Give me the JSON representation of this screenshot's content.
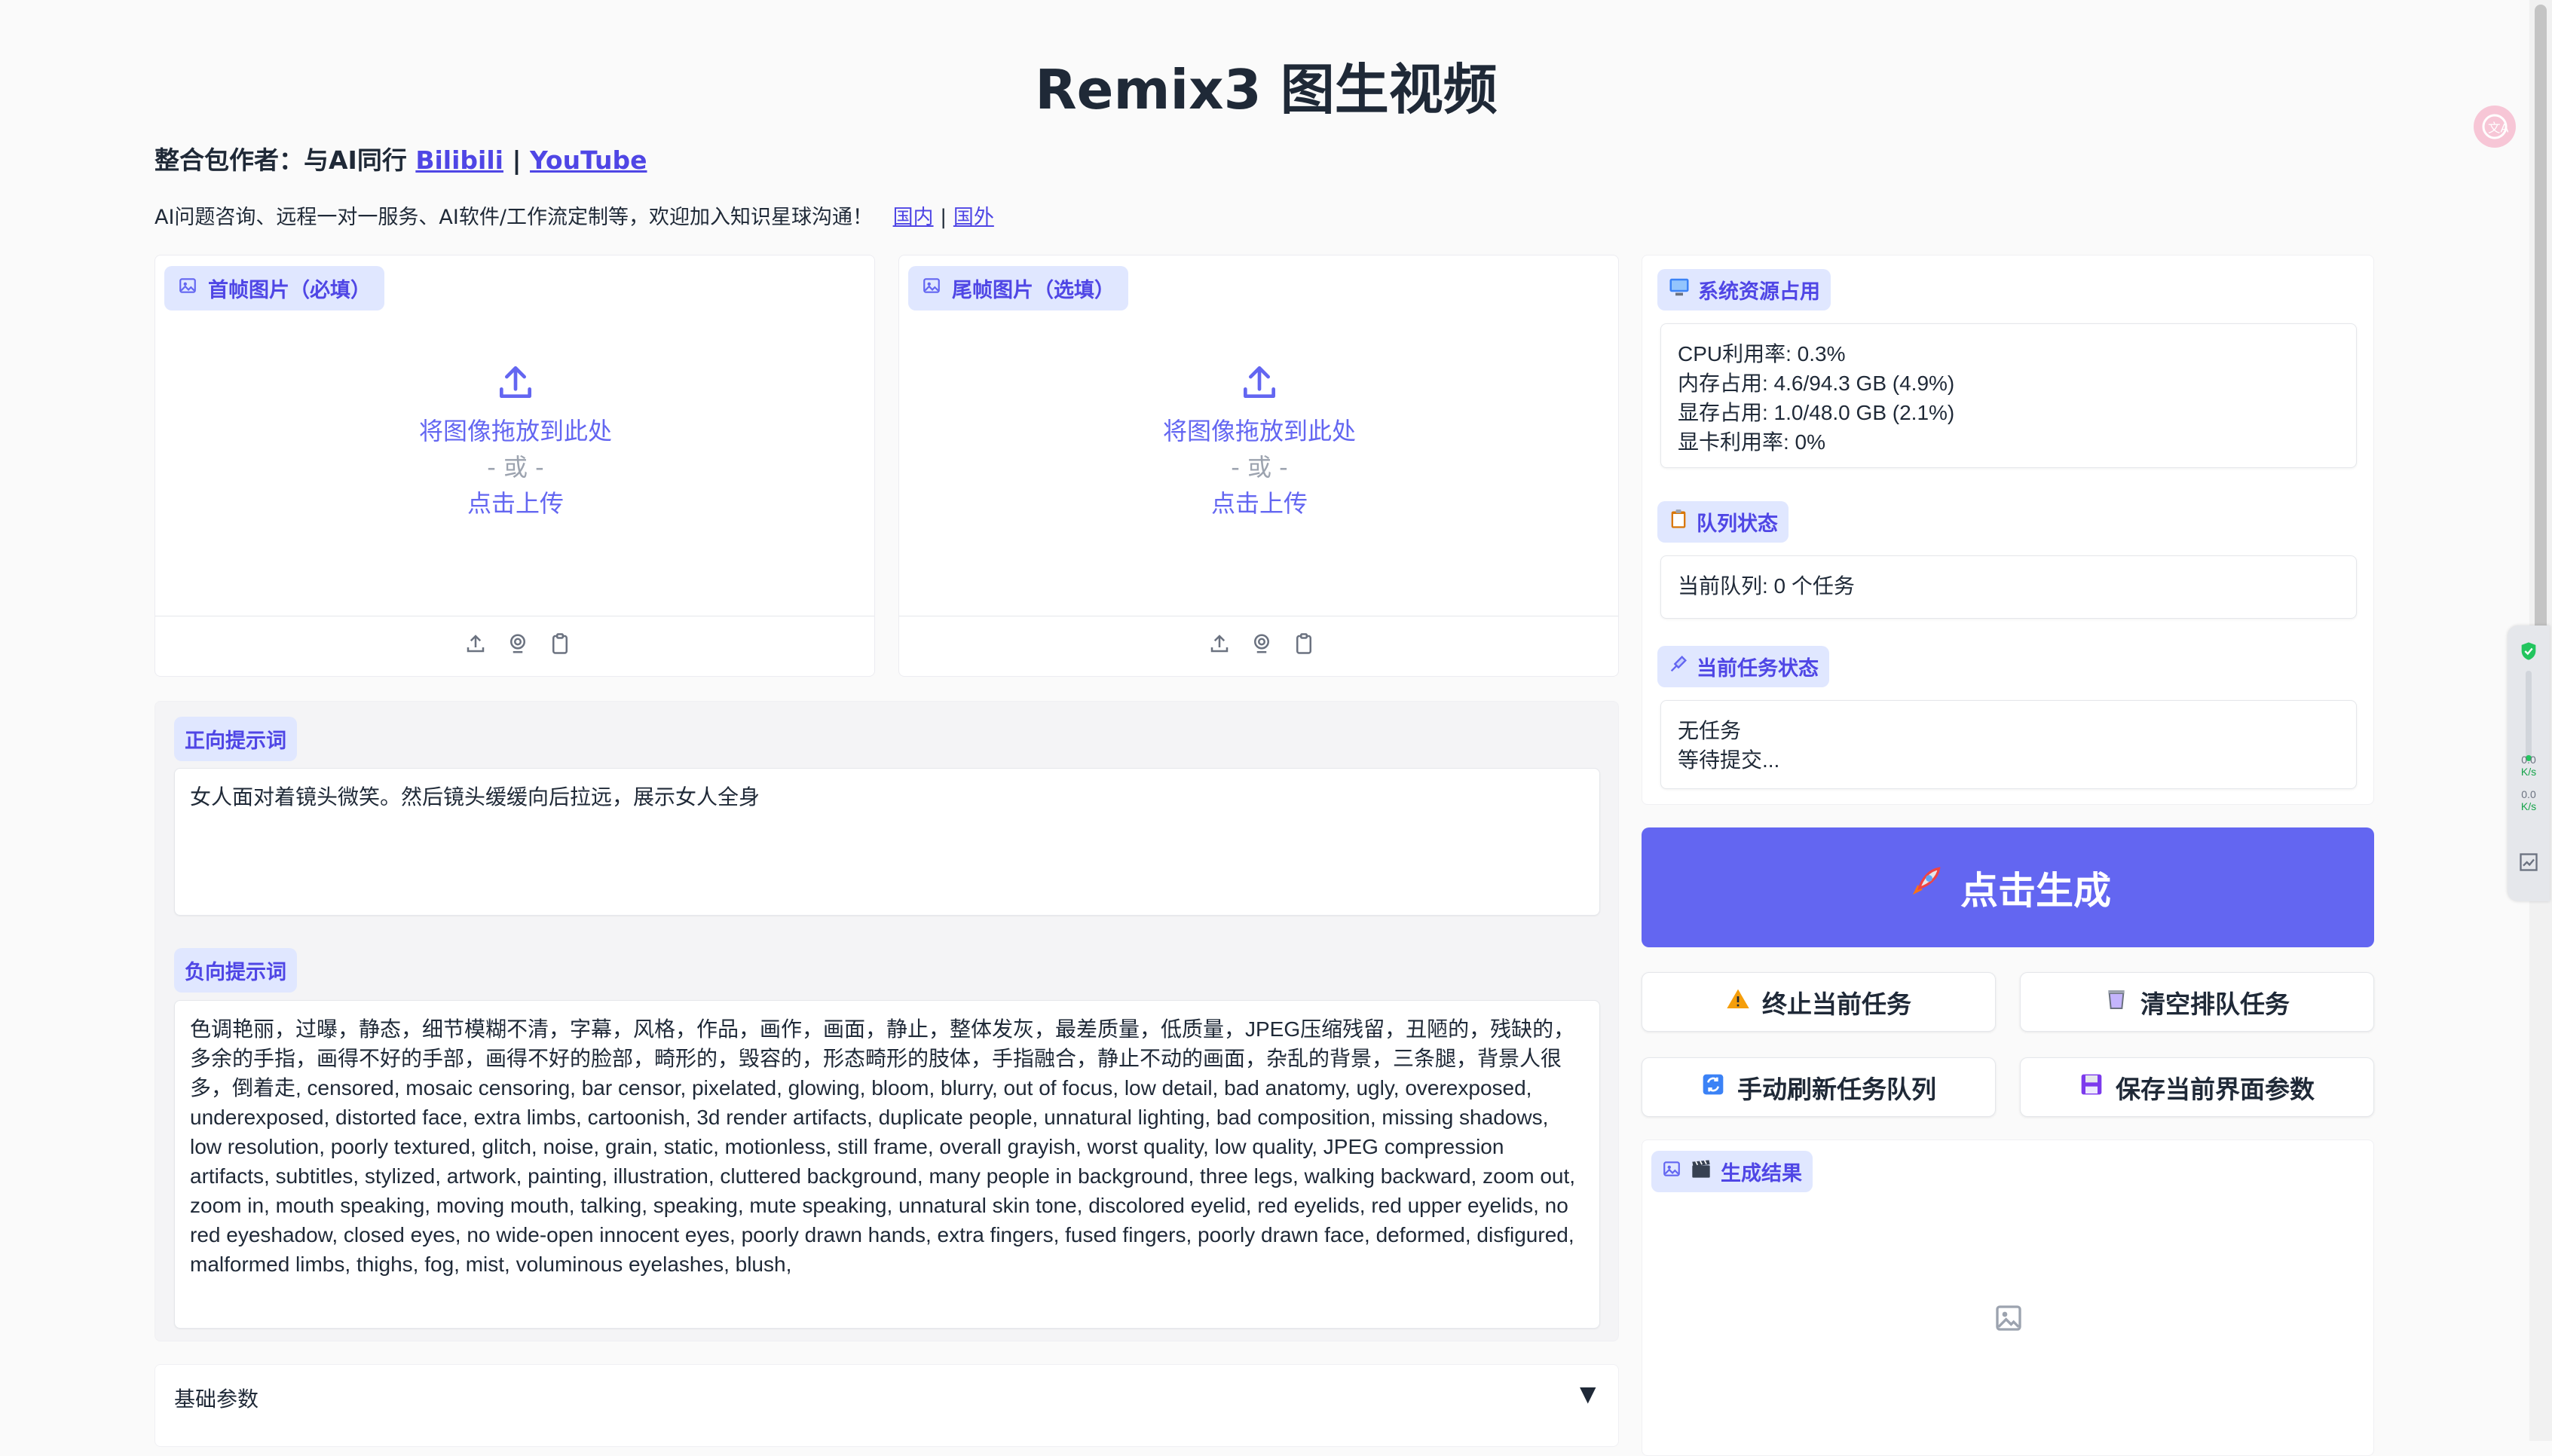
{
  "title": "Remix3 图生视频",
  "author": {
    "prefix": "整合包作者：与AI同行",
    "link1": "Bilibili",
    "sep": "|",
    "link2": "YouTube"
  },
  "consult": {
    "text": "AI问题咨询、远程一对一服务、AI软件/工作流定制等，欢迎加入知识星球沟通！",
    "link1": "国内",
    "sep": "|",
    "link2": "国外"
  },
  "first_frame": {
    "label": "首帧图片（必填）",
    "drop_text": "将图像拖放到此处",
    "or_text": "- 或 -",
    "click_text": "点击上传"
  },
  "last_frame": {
    "label": "尾帧图片（选填）",
    "drop_text": "将图像拖放到此处",
    "or_text": "- 或 -",
    "click_text": "点击上传"
  },
  "positive_prompt": {
    "label": "正向提示词",
    "value": "女人面对着镜头微笑。然后镜头缓缓向后拉远，展示女人全身"
  },
  "negative_prompt": {
    "label": "负向提示词",
    "value": "色调艳丽，过曝，静态，细节模糊不清，字幕，风格，作品，画作，画面，静止，整体发灰，最差质量，低质量，JPEG压缩残留，丑陋的，残缺的，多余的手指，画得不好的手部，画得不好的脸部，畸形的，毁容的，形态畸形的肢体，手指融合，静止不动的画面，杂乱的背景，三条腿，背景人很多，倒着走, censored, mosaic censoring, bar censor, pixelated, glowing, bloom, blurry, out of focus, low detail, bad anatomy, ugly, overexposed, underexposed, distorted face, extra limbs, cartoonish, 3d render artifacts, duplicate people, unnatural lighting, bad composition, missing shadows, low resolution, poorly textured, glitch, noise, grain, static, motionless, still frame, overall grayish, worst quality, low quality, JPEG compression artifacts, subtitles, stylized, artwork, painting, illustration, cluttered background, many people in background, three legs, walking backward, zoom out, zoom in, mouth speaking, moving mouth, talking, speaking, mute speaking, unnatural skin tone, discolored eyelid, red eyelids, red upper eyelids, no red eyeshadow, closed eyes, no wide-open innocent eyes, poorly drawn hands, extra fingers, fused fingers, poorly drawn face, deformed, disfigured, malformed limbs, thighs, fog, mist, voluminous eyelashes, blush,"
  },
  "basic_params": {
    "label": "基础参数",
    "toggle": "▼"
  },
  "system": {
    "label": "系统资源占用",
    "cpu": "CPU利用率: 0.3%",
    "mem": "内存占用: 4.6/94.3 GB (4.9%)",
    "vram": "显存占用: 1.0/48.0 GB (2.1%)",
    "gpu": "显卡利用率: 0%"
  },
  "queue": {
    "label": "队列状态",
    "value": "当前队列: 0 个任务"
  },
  "current_task": {
    "label": "当前任务状态",
    "line1": "无任务",
    "line2": "等待提交..."
  },
  "buttons": {
    "generate": "点击生成",
    "stop": "终止当前任务",
    "clear": "清空排队任务",
    "refresh": "手动刷新任务队列",
    "save": "保存当前界面参数"
  },
  "result": {
    "label": "生成结果"
  },
  "side_widget": {
    "up_speed": "0.0",
    "up_unit": "K/s",
    "down_speed": "0.0",
    "down_unit": "K/s"
  },
  "colors": {
    "accent": "#6366f1",
    "chip_bg": "#e0e7ff",
    "chip_text": "#4f46e5"
  }
}
